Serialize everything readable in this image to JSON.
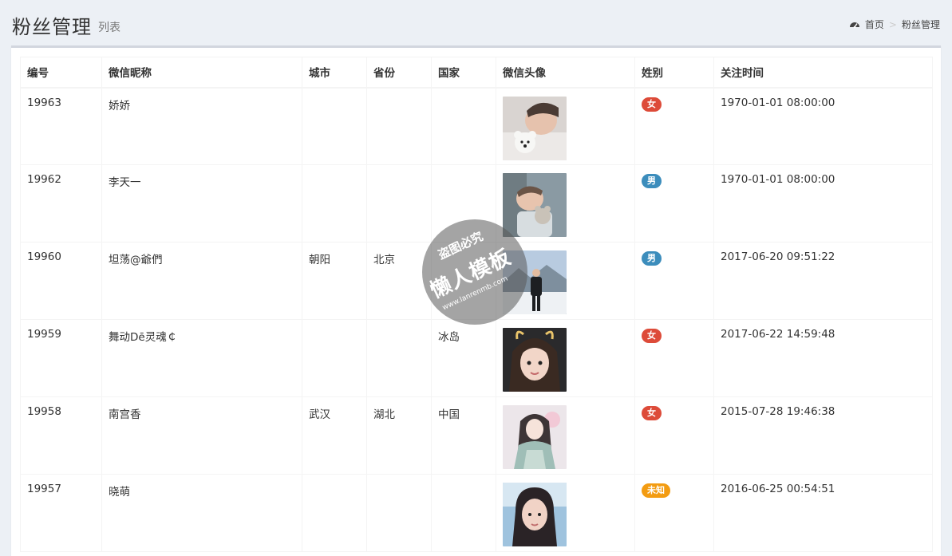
{
  "header": {
    "title": "粉丝管理",
    "subtitle": "列表",
    "breadcrumb": {
      "home": "首页",
      "separator": ">",
      "current": "粉丝管理",
      "icon": "dashboard-icon"
    }
  },
  "table": {
    "columns": [
      "编号",
      "微信昵称",
      "城市",
      "省份",
      "国家",
      "微信头像",
      "姓别",
      "关注时间"
    ],
    "rows": [
      {
        "id": "19963",
        "nickname": "娇娇",
        "city": "",
        "province": "",
        "country": "",
        "gender": "女",
        "gender_color": "#dd4b39",
        "followed_at": "1970-01-01 08:00:00",
        "avatar": "avatar-child-with-teddy-bear"
      },
      {
        "id": "19962",
        "nickname": "李天一",
        "city": "",
        "province": "",
        "country": "",
        "gender": "男",
        "gender_color": "#3c8dbc",
        "followed_at": "1970-01-01 08:00:00",
        "avatar": "avatar-sleeping-baby"
      },
      {
        "id": "19960",
        "nickname": "坦荡@爺們",
        "city": "朝阳",
        "province": "北京",
        "country": "",
        "gender": "男",
        "gender_color": "#3c8dbc",
        "followed_at": "2017-06-20 09:51:22",
        "avatar": "avatar-man-in-snow"
      },
      {
        "id": "19959",
        "nickname": "舞动Dē灵魂￠",
        "city": "",
        "province": "",
        "country": "冰岛",
        "gender": "女",
        "gender_color": "#dd4b39",
        "followed_at": "2017-06-22 14:59:48",
        "avatar": "avatar-girl-with-ears"
      },
      {
        "id": "19958",
        "nickname": "南宫香",
        "city": "武汉",
        "province": "湖北",
        "country": "中国",
        "gender": "女",
        "gender_color": "#dd4b39",
        "followed_at": "2015-07-28 19:46:38",
        "avatar": "avatar-illustrated-woman"
      },
      {
        "id": "19957",
        "nickname": "晓萌",
        "city": "",
        "province": "",
        "country": "",
        "gender": "未知",
        "gender_color": "#f39c12",
        "followed_at": "2016-06-25 00:54:51",
        "avatar": "avatar-woman-portrait"
      }
    ]
  },
  "watermark": {
    "line1": "盗图必究",
    "line2": "懒人模板",
    "line3": "www.lanrenmb.com"
  }
}
